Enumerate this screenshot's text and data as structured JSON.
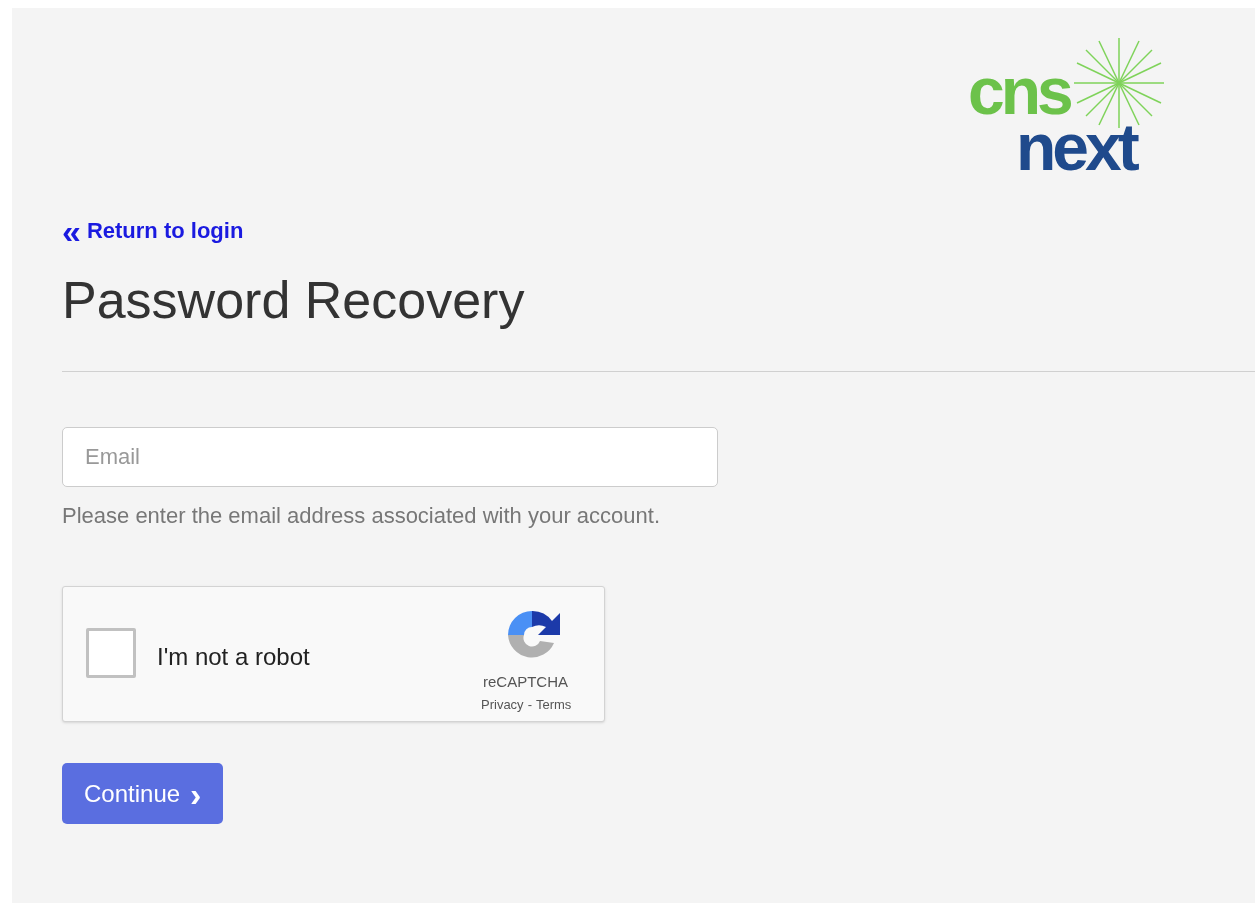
{
  "logo": {
    "top": "cns",
    "bottom": "next"
  },
  "back_link": {
    "icon": "«",
    "label": "Return to login"
  },
  "title": "Password Recovery",
  "email_field": {
    "placeholder": "Email"
  },
  "help_text": "Please enter the email address associated with your account.",
  "captcha": {
    "checked": false,
    "label": "I'm not a robot",
    "brand": "reCAPTCHA",
    "links": [
      "Privacy",
      "Terms"
    ],
    "separator": "-"
  },
  "continue_button": {
    "label": "Continue",
    "icon": "›"
  }
}
